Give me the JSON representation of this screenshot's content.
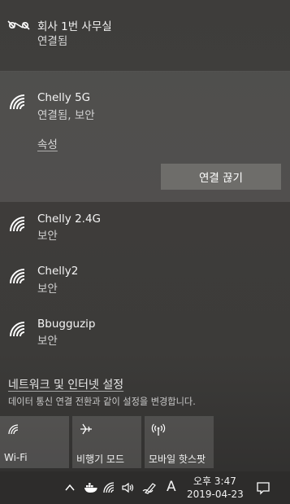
{
  "vpn": {
    "name": "회사 1번 사무실",
    "status": "연결됨",
    "icon": "vpn-icon"
  },
  "networks": {
    "connected": {
      "name": "Chelly 5G",
      "status": "연결됨, 보안",
      "properties_label": "속성",
      "disconnect_label": "연결 끊기"
    },
    "others": [
      {
        "name": "Chelly 2.4G",
        "status": "보안"
      },
      {
        "name": "Chelly2",
        "status": "보안"
      },
      {
        "name": "Bbugguzip",
        "status": "보안"
      }
    ]
  },
  "settings": {
    "link": "네트워크 및 인터넷 설정",
    "desc": "데이터 통신 연결 전환과 같이 설정을 변경합니다."
  },
  "quick_actions": [
    {
      "label": "Wi-Fi",
      "icon": "wifi-icon",
      "active": true
    },
    {
      "label": "비행기 모드",
      "icon": "airplane-icon",
      "active": false
    },
    {
      "label": "모바일 핫스팟",
      "icon": "hotspot-icon",
      "active": false
    }
  ],
  "taskbar": {
    "time": "오후 3:47",
    "date": "2019-04-23",
    "input_indicator": "A"
  }
}
